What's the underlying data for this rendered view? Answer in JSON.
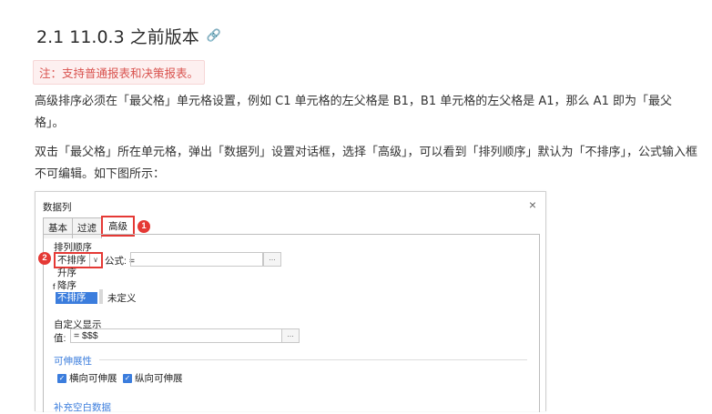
{
  "heading": {
    "title": "2.1 11.0.3 之前版本",
    "link_icon": "🔗"
  },
  "note": "注：支持普通报表和决策报表。",
  "paragraphs": [
    "高级排序必须在「最父格」单元格设置，例如 C1 单元格的左父格是 B1，B1 单元格的左父格是 A1，那么 A1 即为「最父格」。",
    "双击「最父格」所在单元格，弹出「数据列」设置对话框，选择「高级」，可以看到「排列顺序」默认为「不排序」，公式输入框不可编辑。如下图所示："
  ],
  "dialog": {
    "title": "数据列",
    "close": "×",
    "tabs": [
      "基本",
      "过滤",
      "高级"
    ],
    "markers": [
      "1",
      "2"
    ],
    "sort_label": "排列顺序",
    "sort_value": "不排序",
    "sort_arrow": "∨",
    "formula_label": "公式: =",
    "dots": "...",
    "dropdown_options": [
      "升序",
      "降序",
      "不排序"
    ],
    "stray_char": "f",
    "undefined_label": "未定义",
    "custom_display_label": "自定义显示",
    "value_label": "值:",
    "value_input": "= $$$",
    "extensibility_title": "可伸展性",
    "checkbox_horizontal": "横向可伸展",
    "checkbox_vertical": "纵向可伸展",
    "check_mark": "✓",
    "fill_blank_title": "补充空白数据"
  },
  "colors": {
    "accent_red": "#e53935",
    "accent_blue": "#3b7ddd",
    "note_red": "#d9534f"
  }
}
